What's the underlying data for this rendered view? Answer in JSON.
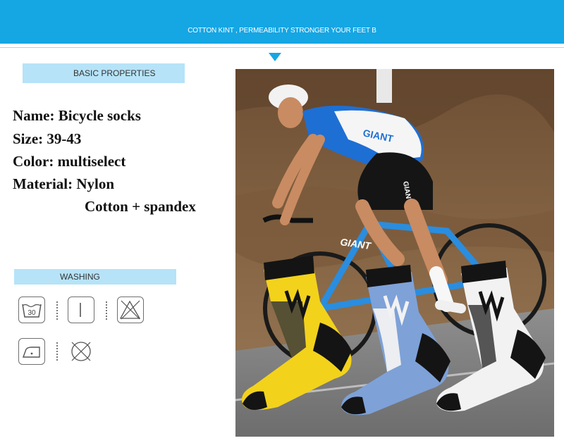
{
  "banner": {
    "text": "COTTON KINT ,  PERMEABILITY STRONGER YOUR FEET B"
  },
  "basic_properties": {
    "heading": "BASIC PROPERTIES",
    "specs": [
      "Name: Bicycle socks",
      "Size: 39-43",
      "Color: multiselect",
      "Material: Nylon",
      "Cotton + spandex"
    ]
  },
  "washing": {
    "heading": "WASHING",
    "wash_temp": "30",
    "icons": [
      "wash-30-icon",
      "hang-dry-icon",
      "no-bleach-icon",
      "iron-low-icon",
      "no-dry-clean-icon"
    ]
  },
  "photo": {
    "jersey_text": "GIANT",
    "bike_text": "GIANT",
    "shorts_text": "GIANT"
  },
  "colors": {
    "brand_blue": "#15a6e4",
    "label_bg": "#b6e3f8",
    "sock_yellow": "#f3d21c",
    "sock_blue": "#7ea1d8",
    "sock_white": "#f2f2f2"
  }
}
